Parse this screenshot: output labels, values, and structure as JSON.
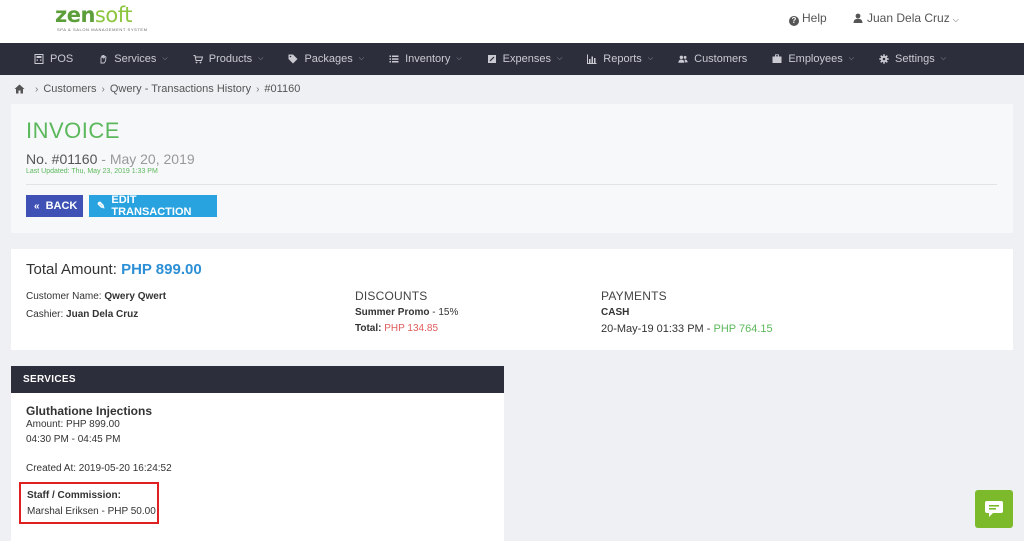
{
  "brand": {
    "name_part1": "zen",
    "name_part2": "soft",
    "tagline": "SPA & SALON MANAGEMENT SYSTEM",
    "primary_color": "#5b9e3a",
    "accent_color": "#8cc63f"
  },
  "header": {
    "help_label": "Help",
    "user_name": "Juan Dela Cruz"
  },
  "nav": {
    "items": [
      {
        "label": "POS",
        "icon": "calculator-icon",
        "dropdown": false
      },
      {
        "label": "Services",
        "icon": "hand-icon",
        "dropdown": true
      },
      {
        "label": "Products",
        "icon": "cart-icon",
        "dropdown": true
      },
      {
        "label": "Packages",
        "icon": "tags-icon",
        "dropdown": true
      },
      {
        "label": "Inventory",
        "icon": "list-icon",
        "dropdown": true
      },
      {
        "label": "Expenses",
        "icon": "receipt-icon",
        "dropdown": true
      },
      {
        "label": "Reports",
        "icon": "bar-chart-icon",
        "dropdown": true
      },
      {
        "label": "Customers",
        "icon": "users-icon",
        "dropdown": false
      },
      {
        "label": "Employees",
        "icon": "briefcase-icon",
        "dropdown": true
      },
      {
        "label": "Settings",
        "icon": "gear-icon",
        "dropdown": true
      }
    ],
    "background_color": "#2d2e3b"
  },
  "breadcrumb": {
    "items": [
      "Customers",
      "Qwery - Transactions History",
      "#01160"
    ]
  },
  "invoice": {
    "title": "INVOICE",
    "number": "No. #01160",
    "date": "May 20, 2019",
    "last_updated": "Last Updated: Thu, May 23, 2019 1:33 PM",
    "back_label": "BACK",
    "edit_label": "EDIT TRANSACTION",
    "title_color": "#5cb85c"
  },
  "totals": {
    "label": "Total Amount:",
    "amount": "PHP 899.00",
    "customer_label": "Customer Name:",
    "customer_name": "Qwery Qwert",
    "cashier_label": "Cashier:",
    "cashier_name": "Juan Dela Cruz",
    "discounts": {
      "heading": "DISCOUNTS",
      "promo_name": "Summer Promo",
      "promo_rate": "15%",
      "total_label": "Total:",
      "total_amount": "PHP 134.85"
    },
    "payments": {
      "heading": "PAYMENTS",
      "method": "CASH",
      "datetime": "20-May-19 01:33 PM",
      "amount": "PHP 764.15"
    }
  },
  "services": {
    "heading": "SERVICES",
    "item": {
      "name": "Gluthatione Injections",
      "amount": "Amount: PHP 899.00",
      "time_range": "04:30 PM - 04:45 PM",
      "created_at": "Created At: 2019-05-20 16:24:52",
      "staff_label": "Staff / Commission:",
      "staff_value": "Marshal Eriksen - PHP 50.00"
    }
  },
  "chat": {
    "icon": "chat-bubble-icon",
    "color": "#7cba2b"
  }
}
